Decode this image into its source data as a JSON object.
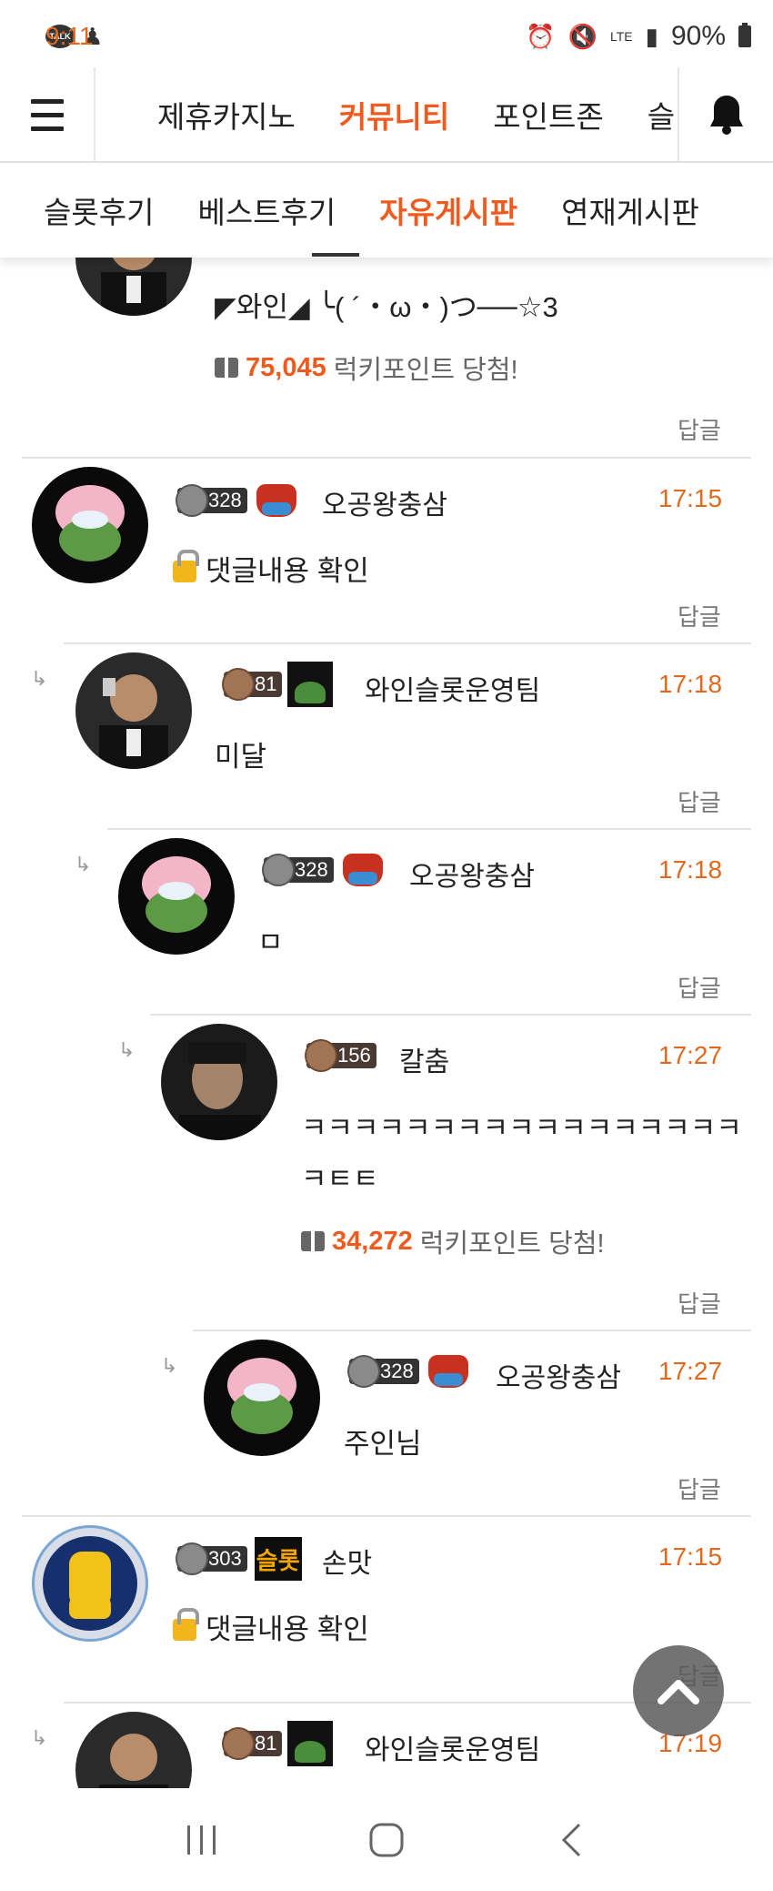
{
  "status_bar": {
    "time": "9:11",
    "talk_label": "TALK",
    "network": "LTE",
    "battery": "90%"
  },
  "top_nav": {
    "tabs": [
      {
        "label": "제휴카지노",
        "active": false
      },
      {
        "label": "커뮤니티",
        "active": true
      },
      {
        "label": "포인트존",
        "active": false
      },
      {
        "label": "슬",
        "active": false
      }
    ]
  },
  "sub_nav": {
    "tabs": [
      {
        "label": "슬롯후기",
        "active": false
      },
      {
        "label": "베스트후기",
        "active": false
      },
      {
        "label": "자유게시판",
        "active": true
      },
      {
        "label": "연재게시판",
        "active": false
      }
    ]
  },
  "comments": [
    {
      "nickname_partial_text": "◤와인◢ ╰( ´・ω・)つ──☆3",
      "lucky_points": "75,045",
      "lucky_label": "럭키포인트 당첨!",
      "reply": "답글"
    },
    {
      "level": "328",
      "nickname": "오공왕충삼",
      "time": "17:15",
      "body": "댓글내용 확인",
      "reply": "답글"
    },
    {
      "level": "81",
      "nickname": "와인슬롯운영팀",
      "time": "17:18",
      "body": "미달",
      "reply": "답글"
    },
    {
      "level": "328",
      "nickname": "오공왕충삼",
      "time": "17:18",
      "body": "ㅁ",
      "reply": "답글"
    },
    {
      "level": "156",
      "nickname": "칼춤",
      "time": "17:27",
      "body_line1": "ㅋㅋㅋㅋㅋㅋㅋㅋㅋㅋㅋㅋㅋㅋㅋㅋㅋ",
      "body_line2": "ㅋㅌㅌ",
      "lucky_points": "34,272",
      "lucky_label": "럭키포인트 당첨!",
      "reply": "답글"
    },
    {
      "level": "328",
      "nickname": "오공왕충삼",
      "time": "17:27",
      "body": "주인님",
      "reply": "답글"
    },
    {
      "level": "303",
      "badge": "슬롯",
      "nickname": "손맛",
      "time": "17:15",
      "body": "댓글내용 확인",
      "reply": "답글"
    },
    {
      "level": "81",
      "nickname": "와인슬롯운영팀",
      "time": "17:19"
    }
  ]
}
